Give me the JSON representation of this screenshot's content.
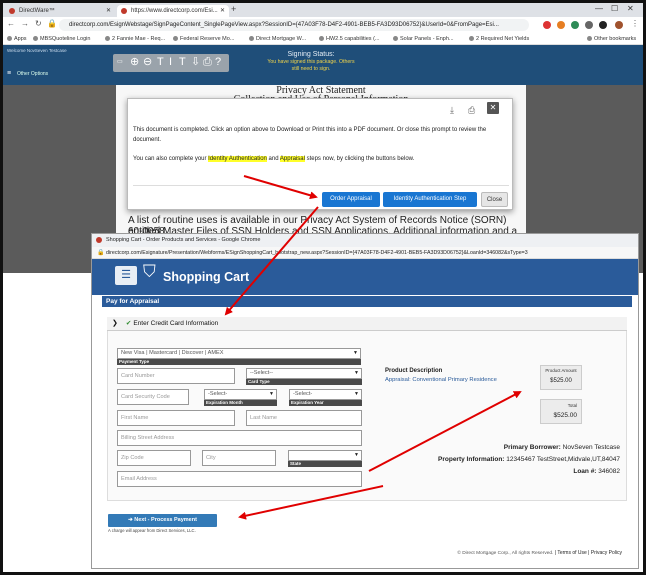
{
  "back_browser": {
    "tabs": [
      {
        "label": "DirectWare™"
      },
      {
        "label": "https://www.directcorp.com/Esi..."
      }
    ],
    "url": "directcorp.com/EsignWebstage/SignPageContent_SinglePageView.aspx?SessionID={47A03F78-D4F2-4901-BEB5-FA3D93D06752}&UserId=0&FromPage=Esi...",
    "bookmarks": [
      "Apps",
      "MBSQuoteline Login",
      "2 Fannie Mae - Req...",
      "Federal Reserve Mo...",
      "Direct Mortgage W...",
      "HW2.5 capabilities (...",
      "Solar Panels - Enph...",
      "2 Required Net Yields",
      "Other bookmarks"
    ],
    "app": {
      "welcome": "Welcome NovSeven Testcase",
      "options": "Other Options",
      "signing_title": "Signing Status:",
      "signing_line1": "You have signed this package. Others",
      "signing_line2": "still need to sign."
    },
    "doc": {
      "title1": "Privacy Act Statement",
      "title2": "Collection and Use of Personal Information",
      "line_a": "A list of routine uses is available in our Privacy Act System of Records Notice (SORN) 60-0058,",
      "line_b": "entitled Master Files of SSN Holders and SSN Applications. Additional information and a full listing of"
    },
    "modal": {
      "line1": "This document is completed. Click an option above to Download or Print this into a PDF document. Or close this prompt to review the",
      "line2": "document.",
      "pre": "You can also complete your ",
      "hl1": "Identity Authentication",
      "mid": " and ",
      "hl2": "Appraisal",
      "post": " steps now, by clicking the buttons below.",
      "btn_order": "Order Appraisal",
      "btn_identity": "Identity Authentication Step",
      "btn_close": "Close"
    }
  },
  "front_window": {
    "title": "Shopping Cart - Order Products and Services - Google Chrome",
    "url": "directcorp.com/Esignature/Presentation/Webforms/ESignShoppingCart_bootstrap_new.aspx?SessionID={47A03F78-D4F2-4901-BEB5-FA3D93D06752}&LoanId=346082&sType=3",
    "header_title": "Shopping Cart",
    "pay_bar": "Pay for Appraisal",
    "cc_header": "Enter Credit Card Information",
    "form": {
      "payment_type_value": "New Visa | Mastercard | Discover | AMEX",
      "payment_type_label": "Payment Type",
      "card_number": "Card Number",
      "card_type_value": "--Select--",
      "card_type_label": "Card Type",
      "security_code": "Card Security Code",
      "exp_month_value": "-Select-",
      "exp_month_label": "Expiration Month",
      "exp_year_value": "-Select-",
      "exp_year_label": "Expiration Year",
      "first_name": "First Name",
      "last_name": "Last Name",
      "billing_address": "Billing Street Address",
      "zip": "Zip Code",
      "city": "City",
      "state_value": "",
      "state_label": "State",
      "email": "Email Address"
    },
    "product": {
      "desc_title": "Product Description",
      "desc_value": "Appraisal: Conventional Primary Residence",
      "amount_caption": "Product Amount",
      "amount_value": "$525.00",
      "total_caption": "Total",
      "total_value": "$525.00"
    },
    "borrower": {
      "primary_label": "Primary Borrower:",
      "primary_value": "NovSeven Testcase",
      "property_label": "Property Information:",
      "property_value": "12345467 TestStreet,Midvale,UT,84047",
      "loan_label": "Loan #:",
      "loan_value": "346082"
    },
    "next_button": "Next - Process Payment",
    "charge_note": "A charge will appear from Direct Services, LLC.",
    "footer_copy": "© Direct Mortgage Corp., All rights Reserved.",
    "footer_terms": "Terms of Use",
    "footer_privacy": "Privacy Policy"
  },
  "colors": {
    "arrow": "#e00000",
    "brand_blue": "#2a5b9a",
    "button_blue": "#1976d2"
  }
}
